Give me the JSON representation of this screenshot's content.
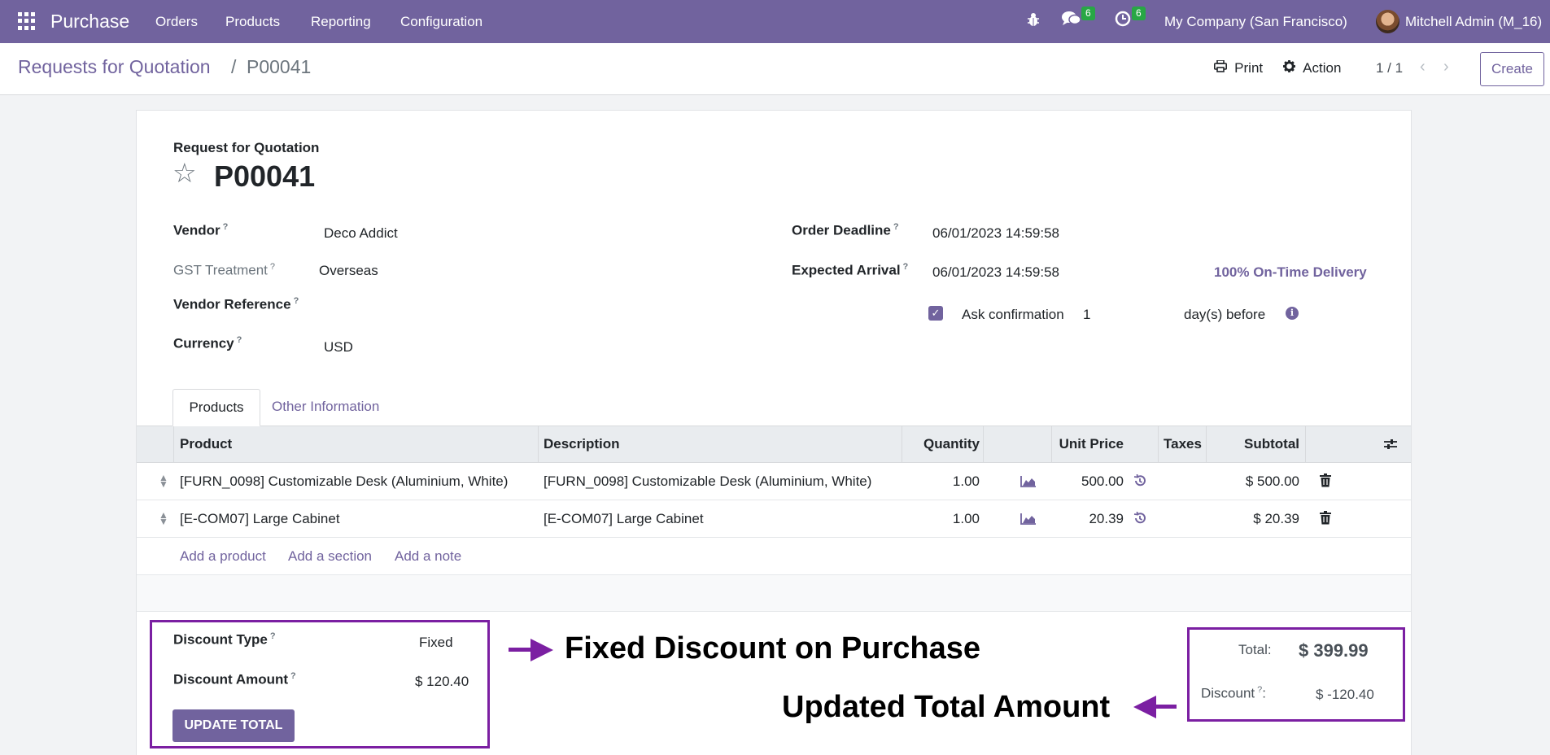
{
  "navbar": {
    "app_name": "Purchase",
    "menu": [
      "Orders",
      "Products",
      "Reporting",
      "Configuration"
    ],
    "messages_count": "6",
    "activities_count": "6",
    "company": "My Company (San Francisco)",
    "user": "Mitchell Admin (M_16)"
  },
  "control": {
    "breadcrumb_parent": "Requests for Quotation",
    "breadcrumb_sep": "/",
    "breadcrumb_current": "P00041",
    "print_label": "Print",
    "action_label": "Action",
    "pager": "1 / 1",
    "create_label": "Create"
  },
  "form": {
    "record_type": "Request for Quotation",
    "reference": "P00041",
    "vendor_label": "Vendor",
    "vendor_value": "Deco Addict",
    "gst_label": "GST Treatment",
    "gst_value": "Overseas",
    "vendor_ref_label": "Vendor Reference",
    "currency_label": "Currency",
    "currency_value": "USD",
    "order_deadline_label": "Order Deadline",
    "order_deadline_value": "06/01/2023 14:59:58",
    "expected_arrival_label": "Expected Arrival",
    "expected_arrival_value": "06/01/2023 14:59:58",
    "on_time_delivery": "100% On-Time Delivery",
    "ask_confirmation_label": "Ask confirmation",
    "ask_confirmation_days": "1",
    "days_before_label": "day(s) before",
    "help_mark": "?"
  },
  "tabs": [
    "Products",
    "Other Information"
  ],
  "table": {
    "headers": [
      "Product",
      "Description",
      "Quantity",
      "Unit Price",
      "Taxes",
      "Subtotal"
    ],
    "rows": [
      {
        "product": "[FURN_0098] Customizable Desk (Aluminium, White)",
        "description": "[FURN_0098] Customizable Desk (Aluminium, White)",
        "quantity": "1.00",
        "unit_price": "500.00",
        "taxes": "",
        "subtotal": "$ 500.00"
      },
      {
        "product": "[E-COM07] Large Cabinet",
        "description": "[E-COM07] Large Cabinet",
        "quantity": "1.00",
        "unit_price": "20.39",
        "taxes": "",
        "subtotal": "$ 20.39"
      }
    ],
    "add_product": "Add a product",
    "add_section": "Add a section",
    "add_note": "Add a note"
  },
  "discount": {
    "type_label": "Discount Type",
    "type_value": "Fixed",
    "amount_label": "Discount Amount",
    "amount_value": "$ 120.40",
    "update_button": "UPDATE TOTAL"
  },
  "totals": {
    "total_label": "Total:",
    "total_value": "$ 399.99",
    "discount_label": "Discount",
    "discount_colon": ":",
    "discount_value": "$ -120.40"
  },
  "annotations": {
    "fixed_discount": "Fixed Discount on Purchase",
    "updated_total": "Updated Total Amount",
    "arrow_color": "#7b1fa2"
  },
  "colors": {
    "brand": "#71639e",
    "badge": "#28a745"
  }
}
